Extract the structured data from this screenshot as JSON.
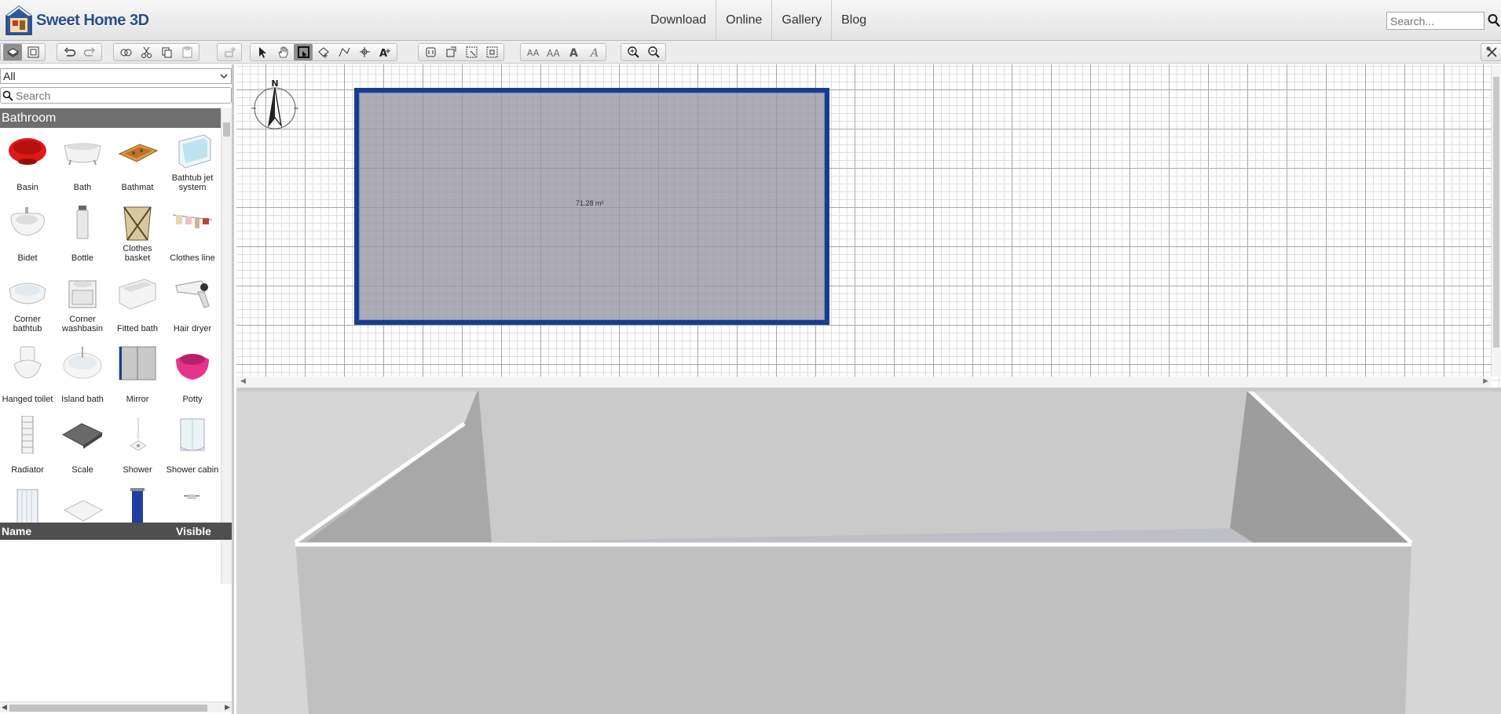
{
  "header": {
    "logo_text": "Sweet Home 3D",
    "nav": [
      {
        "label": "Download"
      },
      {
        "label": "Online"
      },
      {
        "label": "Gallery"
      },
      {
        "label": "Blog"
      }
    ],
    "search_placeholder": "Search..."
  },
  "toolbar": {
    "groups": [
      [
        "furniture-catalog-view-icon",
        "furniture-list-view-icon"
      ],
      [
        "undo-icon",
        "redo-icon"
      ],
      [
        "cut-special-icon",
        "cut-icon",
        "copy-icon",
        "paste-icon"
      ],
      [
        "add-furniture-icon"
      ],
      [
        "select-icon",
        "pan-icon",
        "create-walls-icon",
        "create-rooms-icon",
        "create-polylines-icon",
        "create-dimensions-icon",
        "create-labels-icon"
      ],
      [
        "import-furniture-icon",
        "import-texture-icon",
        "modify-rooms-icon",
        "modify-walls-icon"
      ],
      [
        "decrease-text-size-icon",
        "increase-text-size-icon",
        "bold-text-icon",
        "italic-text-icon"
      ],
      [
        "zoom-in-icon",
        "zoom-out-icon"
      ]
    ],
    "active_tool": "create-walls-icon"
  },
  "catalog": {
    "category_select": "All",
    "search_placeholder": "Search",
    "category_header": "Bathroom",
    "items": [
      {
        "label": "Basin",
        "icon": "basin-icon"
      },
      {
        "label": "Bath",
        "icon": "bath-icon"
      },
      {
        "label": "Bathmat",
        "icon": "bathmat-icon"
      },
      {
        "label": "Bathtub jet system",
        "icon": "bathtub-jet-icon"
      },
      {
        "label": "Bidet",
        "icon": "bidet-icon"
      },
      {
        "label": "Bottle",
        "icon": "bottle-icon"
      },
      {
        "label": "Clothes basket",
        "icon": "clothes-basket-icon"
      },
      {
        "label": "Clothes line",
        "icon": "clothes-line-icon"
      },
      {
        "label": "Corner bathtub",
        "icon": "corner-bathtub-icon"
      },
      {
        "label": "Corner washbasin",
        "icon": "corner-washbasin-icon"
      },
      {
        "label": "Fitted bath",
        "icon": "fitted-bath-icon"
      },
      {
        "label": "Hair dryer",
        "icon": "hair-dryer-icon"
      },
      {
        "label": "Hanged toilet",
        "icon": "hanged-toilet-icon"
      },
      {
        "label": "Island bath",
        "icon": "island-bath-icon"
      },
      {
        "label": "Mirror",
        "icon": "mirror-icon"
      },
      {
        "label": "Potty",
        "icon": "potty-icon"
      },
      {
        "label": "Radiator",
        "icon": "radiator-icon"
      },
      {
        "label": "Scale",
        "icon": "scale-icon"
      },
      {
        "label": "Shower",
        "icon": "shower-icon"
      },
      {
        "label": "Shower cabin",
        "icon": "shower-cabin-icon"
      },
      {
        "label": "",
        "icon": "shower-curtain-icon"
      },
      {
        "label": "",
        "icon": "shower-tray-icon"
      },
      {
        "label": "",
        "icon": "towel-icon"
      },
      {
        "label": "",
        "icon": "shower-head-icon"
      }
    ]
  },
  "furniture_list": {
    "columns": [
      "Name",
      "Visible"
    ]
  },
  "plan": {
    "compass_label": "N",
    "room_area": "71.28 m²"
  },
  "colors": {
    "wall_selection": "#163e8e",
    "room_fill": "#96949f",
    "category_header": "#6f6f6f",
    "list_header": "#4f4f4f"
  }
}
